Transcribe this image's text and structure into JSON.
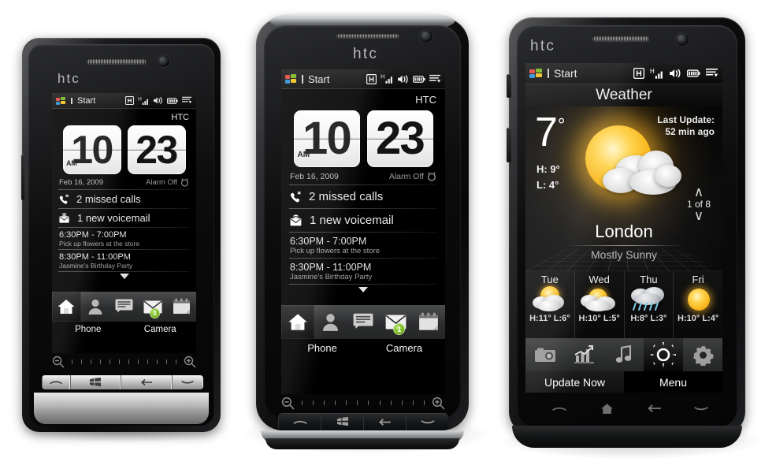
{
  "meta": {
    "background_hex": "#ffffff",
    "accent_green": "#6fae17",
    "sun_yellow": "#f8b81e"
  },
  "statusbar": {
    "start_label": "Start",
    "icons": [
      "bluetooth-h-icon",
      "hsdpa-signal-icon",
      "volume-mute-icon",
      "battery-icon",
      "notification-list-icon"
    ]
  },
  "phone_left": {
    "brand": "htc",
    "carrier": "HTC",
    "clock": {
      "hour": "10",
      "minute": "23",
      "ampm": "AM"
    },
    "date": "Feb 16, 2009",
    "alarm": "Alarm Off",
    "notifications": [
      {
        "icon": "missed-call-icon",
        "text": "2 missed calls"
      },
      {
        "icon": "voicemail-icon",
        "text": "1 new voicemail"
      }
    ],
    "appointments": [
      {
        "time": "6:30PM - 7:00PM",
        "subject": "Pick up flowers at the store"
      },
      {
        "time": "8:30PM - 11:00PM",
        "subject": "Jasmine's Birthday Party"
      }
    ],
    "dock": [
      "home-icon",
      "contacts-icon",
      "messages-icon",
      "mail-icon",
      "calendar-icon"
    ],
    "mail_badge": "1",
    "softkeys": {
      "left": "Phone",
      "right": "Camera"
    },
    "hardware_keys": [
      "send-call-key",
      "windows-start-key",
      "back-key",
      "end-call-key"
    ]
  },
  "phone_middle": {
    "brand": "htc",
    "carrier": "HTC",
    "clock": {
      "hour": "10",
      "minute": "23",
      "ampm": "AM"
    },
    "date": "Feb 16, 2009",
    "alarm": "Alarm Off",
    "notifications": [
      {
        "icon": "missed-call-icon",
        "text": "2 missed calls"
      },
      {
        "icon": "voicemail-icon",
        "text": "1 new voicemail"
      }
    ],
    "appointments": [
      {
        "time": "6:30PM - 7:00PM",
        "subject": "Pick up flowers at the store"
      },
      {
        "time": "8:30PM - 11:00PM",
        "subject": "Jasmine's Birthday Party"
      }
    ],
    "dock": [
      "home-icon",
      "contacts-icon",
      "messages-icon",
      "mail-icon",
      "calendar-icon"
    ],
    "mail_badge": "1",
    "softkeys": {
      "left": "Phone",
      "right": "Camera"
    },
    "hardware_keys": [
      "send-call-key",
      "windows-start-key",
      "back-key",
      "end-call-key"
    ]
  },
  "phone_right": {
    "brand": "htc",
    "title": "Weather",
    "current": {
      "temperature": "7",
      "degree": "°",
      "high": "H: 9°",
      "low": "L: 4°",
      "city": "London",
      "condition": "Mostly Sunny",
      "icon": "sun-behind-cloud-icon"
    },
    "last_update": {
      "label": "Last Update:",
      "value": "52 min ago"
    },
    "pager": {
      "text": "1 of 8",
      "up": "∧",
      "down": "∨"
    },
    "forecast": [
      {
        "day": "Tue",
        "icon": "sun-behind-cloud-icon",
        "temps": "H:11° L:6°"
      },
      {
        "day": "Wed",
        "icon": "sun-behind-cloud-icon",
        "temps": "H:10° L:5°"
      },
      {
        "day": "Thu",
        "icon": "rain-cloud-icon",
        "temps": "H:8° L:3°"
      },
      {
        "day": "Fri",
        "icon": "sun-icon",
        "temps": "H:10° L:4°"
      }
    ],
    "dock": [
      "camera-icon",
      "stocks-icon",
      "music-icon",
      "weather-sun-icon",
      "settings-gear-icon"
    ],
    "softkeys": {
      "left": "Update Now",
      "right": "Menu"
    },
    "hardware_keys": [
      "send-call-key",
      "home-key",
      "back-key",
      "end-call-key"
    ]
  }
}
